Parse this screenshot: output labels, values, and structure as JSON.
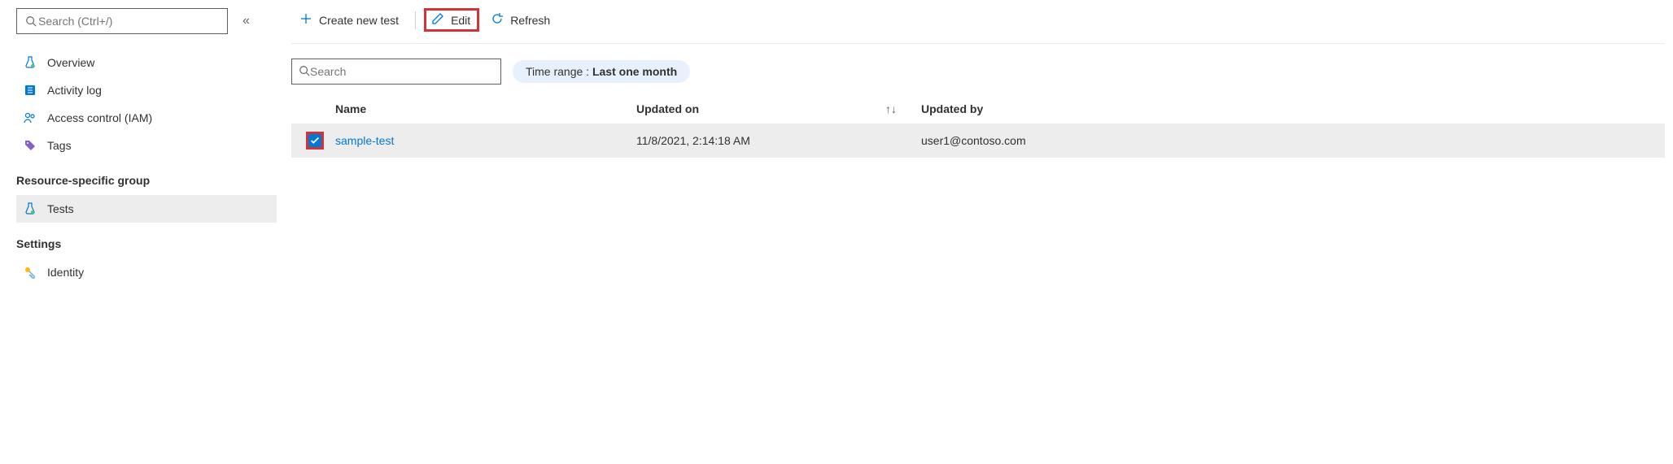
{
  "sidebar": {
    "search_placeholder": "Search (Ctrl+/)",
    "items": [
      {
        "label": "Overview",
        "icon": "flask-icon"
      },
      {
        "label": "Activity log",
        "icon": "log-icon"
      },
      {
        "label": "Access control (IAM)",
        "icon": "people-icon"
      },
      {
        "label": "Tags",
        "icon": "tag-icon"
      }
    ],
    "section1_label": "Resource-specific group",
    "section1_items": [
      {
        "label": "Tests",
        "icon": "flask-icon",
        "selected": true
      }
    ],
    "section2_label": "Settings",
    "section2_items": [
      {
        "label": "Identity",
        "icon": "key-icon"
      }
    ]
  },
  "toolbar": {
    "create_label": "Create new test",
    "edit_label": "Edit",
    "refresh_label": "Refresh"
  },
  "filter": {
    "search_placeholder": "Search",
    "time_range_prefix": "Time range : ",
    "time_range_value": "Last one month"
  },
  "table": {
    "headers": {
      "name": "Name",
      "updated_on": "Updated on",
      "updated_by": "Updated by"
    },
    "rows": [
      {
        "name": "sample-test",
        "updated_on": "11/8/2021, 2:14:18 AM",
        "updated_by": "user1@contoso.com",
        "checked": true
      }
    ]
  }
}
